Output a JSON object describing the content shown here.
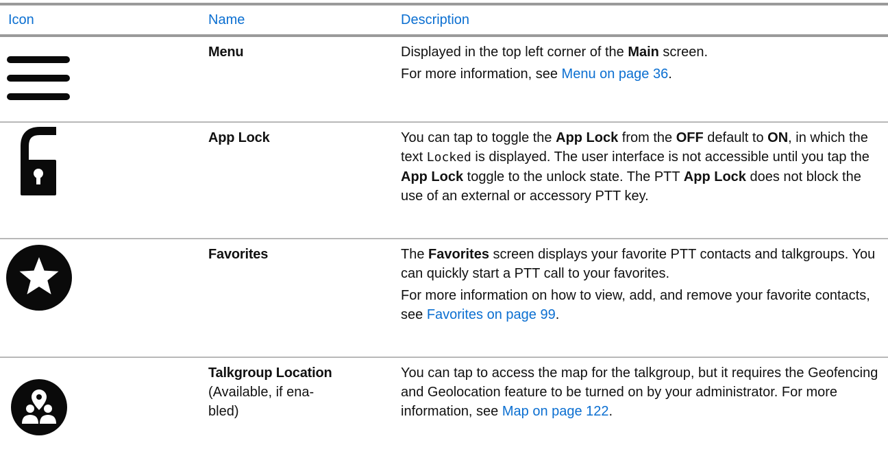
{
  "header": {
    "icon": "Icon",
    "name": "Name",
    "description": "Description"
  },
  "rows": [
    {
      "icon": "menu-icon",
      "name": "Menu",
      "desc": {
        "s1a": "Displayed in the top left corner of the ",
        "s1b": "Main",
        "s1c": " screen.",
        "s2a": "For more information, see ",
        "s2link": "Menu on page 36",
        "s2end": "."
      }
    },
    {
      "icon": "unlock-icon",
      "name": "App Lock",
      "desc": {
        "a": "You can tap to toggle the ",
        "b": "App Lock",
        "c": " from the ",
        "d": "OFF",
        "e": " default to ",
        "f": "ON",
        "g": ", in which the text ",
        "h": "Locked",
        "i": " is displayed. The user interface is not accessible until you tap the ",
        "j": "App Lock",
        "k": " toggle to the unlock state. The PTT ",
        "l": "App Lock",
        "m": " does not block the use of an external or accessory PTT key."
      }
    },
    {
      "icon": "star-icon",
      "name": "Favorites",
      "desc": {
        "p1a": "The ",
        "p1b": "Favorites",
        "p1c": " screen displays your favorite PTT contacts and talkgroups. You can quickly start a PTT call to your favorites.",
        "p2a": "For more information on how to view, add, and remove your favorite contacts, see ",
        "p2link": "Favorites on page 99",
        "p2end": "."
      }
    },
    {
      "icon": "talkgroup-location-icon",
      "name": "Talkgroup Location",
      "name_sub1": "(Available, if ena-",
      "name_sub2": "bled)",
      "desc": {
        "a": "You can tap to access the map for the talkgroup, but it requires the Geofencing and Geolocation feature to be turned on by your administrator. For more information, see ",
        "link": "Map on page 122",
        "end": "."
      }
    }
  ]
}
